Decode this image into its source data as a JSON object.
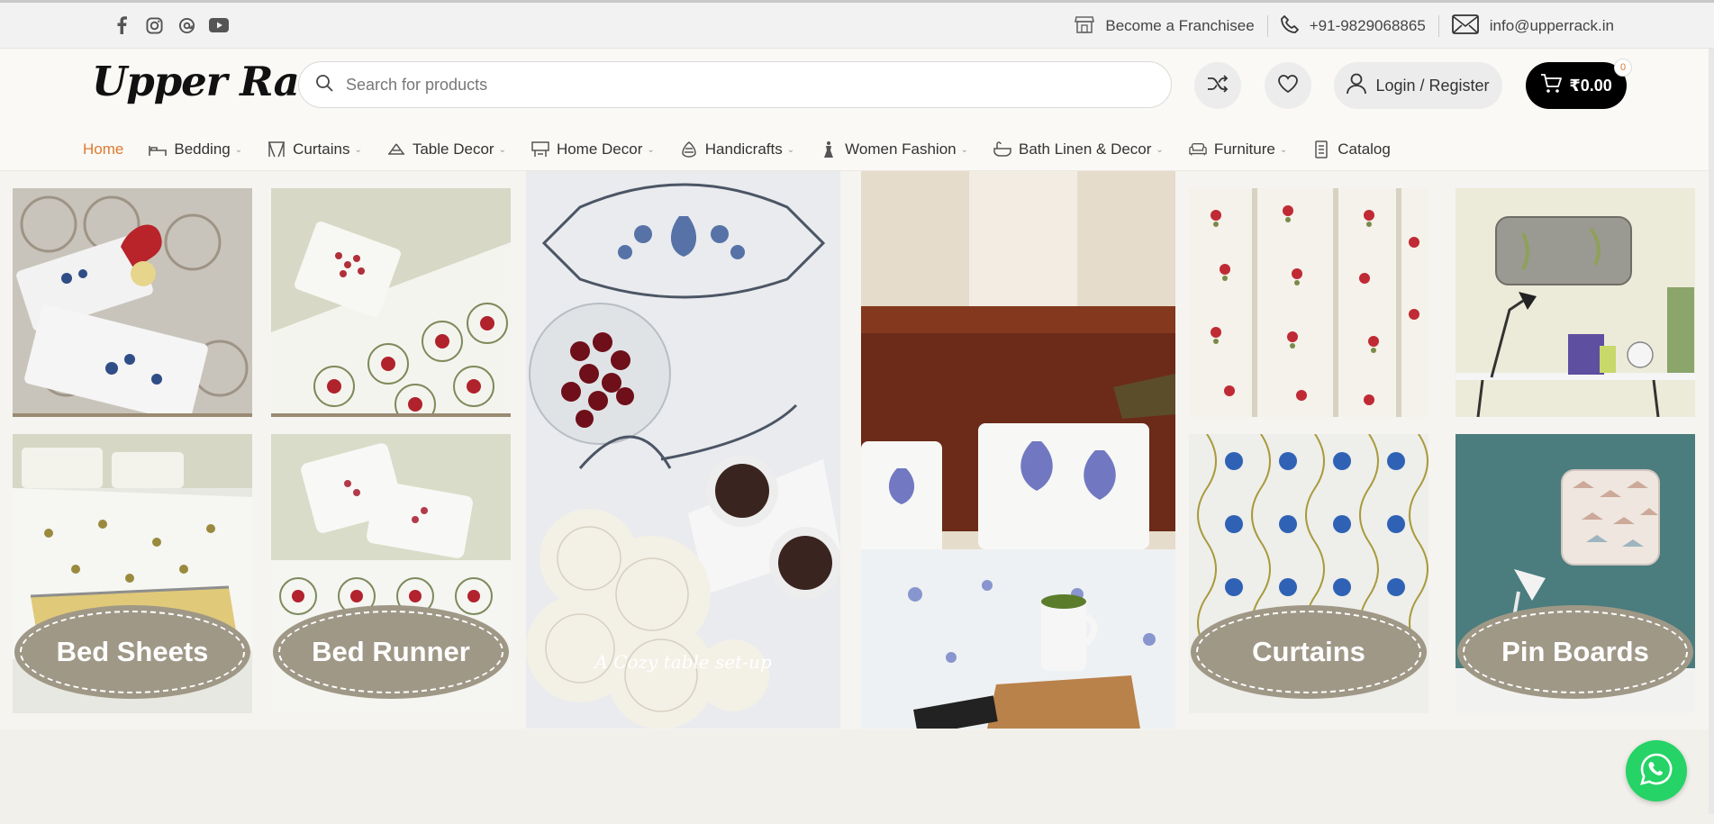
{
  "topbar": {
    "social": [
      {
        "name": "facebook-icon"
      },
      {
        "name": "instagram-icon"
      },
      {
        "name": "threads-icon"
      },
      {
        "name": "youtube-icon"
      }
    ],
    "franchise_label": "Become a Franchisee",
    "phone_label": "+91-9829068865",
    "email_label": "info@upperrack.in"
  },
  "header": {
    "logo": "Upper Rack",
    "search_placeholder": "Search for products",
    "login_label": "Login / Register",
    "cart_total": "₹0.00",
    "cart_count": "0"
  },
  "nav": [
    {
      "label": "Home",
      "icon": "",
      "dropdown": false,
      "active": true
    },
    {
      "label": "Bedding",
      "icon": "bed-icon",
      "dropdown": true
    },
    {
      "label": "Curtains",
      "icon": "curtain-icon",
      "dropdown": true
    },
    {
      "label": "Table Decor",
      "icon": "table-decor-icon",
      "dropdown": true
    },
    {
      "label": "Home Decor",
      "icon": "home-decor-icon",
      "dropdown": true
    },
    {
      "label": "Handicrafts",
      "icon": "handicraft-icon",
      "dropdown": true
    },
    {
      "label": "Women Fashion",
      "icon": "dress-icon",
      "dropdown": true
    },
    {
      "label": "Bath Linen & Decor",
      "icon": "bath-icon",
      "dropdown": true
    },
    {
      "label": "Furniture",
      "icon": "sofa-icon",
      "dropdown": true
    },
    {
      "label": "Catalog",
      "icon": "catalog-icon",
      "dropdown": false
    }
  ],
  "banner": {
    "bed_sheets_label": "Bed Sheets",
    "bed_runner_label": "Bed Runner",
    "table_caption": "A Cozy table set-up",
    "curtains_label": "Curtains",
    "pin_boards_label": "Pin Boards"
  },
  "colors": {
    "accent": "#e07a2f",
    "oval": "#a09887",
    "whatsapp": "#25d366"
  }
}
